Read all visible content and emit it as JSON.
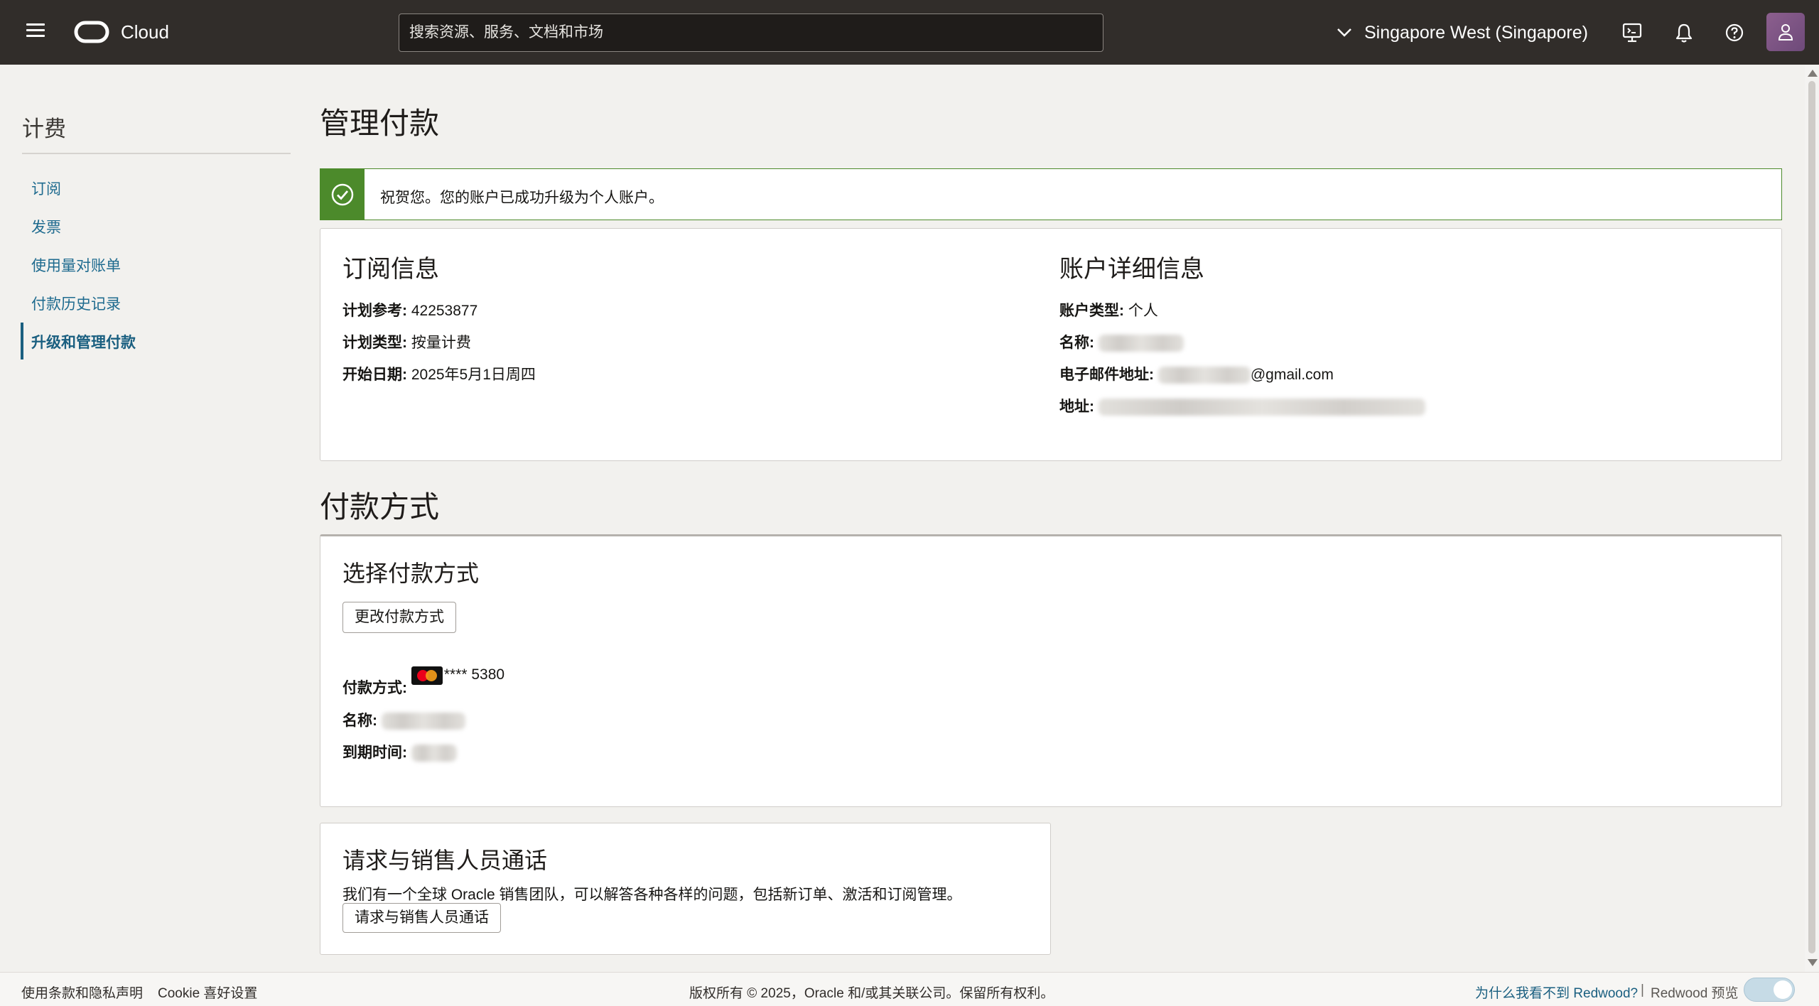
{
  "header": {
    "brand": "Cloud",
    "search_placeholder": "搜索资源、服务、文档和市场",
    "region": "Singapore West (Singapore)"
  },
  "sidebar": {
    "title": "计费",
    "items": [
      {
        "label": "订阅"
      },
      {
        "label": "发票"
      },
      {
        "label": "使用量对账单"
      },
      {
        "label": "付款历史记录"
      },
      {
        "label": "升级和管理付款"
      }
    ]
  },
  "main": {
    "title": "管理付款",
    "alert": "祝贺您。您的账户已成功升级为个人账户。",
    "subscription": {
      "heading": "订阅信息",
      "plan_ref_label": "计划参考:",
      "plan_ref_value": "42253877",
      "plan_type_label": "计划类型:",
      "plan_type_value": "按量计费",
      "start_date_label": "开始日期:",
      "start_date_value": "2025年5月1日周四"
    },
    "account": {
      "heading": "账户详细信息",
      "type_label": "账户类型:",
      "type_value": "个人",
      "name_label": "名称:",
      "email_label": "电子邮件地址:",
      "email_suffix": "@gmail.com",
      "address_label": "地址:"
    },
    "payment_section_title": "付款方式",
    "payment": {
      "heading": "选择付款方式",
      "change_button": "更改付款方式",
      "method_label": "付款方式:",
      "card_number": "**** 5380",
      "name_label": "名称:",
      "expiry_label": "到期时间:"
    },
    "sales": {
      "heading": "请求与销售人员通话",
      "description": "我们有一个全球 Oracle 销售团队，可以解答各种各样的问题，包括新订单、激活和订阅管理。",
      "button": "请求与销售人员通话"
    }
  },
  "footer": {
    "terms": "使用条款和隐私声明",
    "cookie": "Cookie 喜好设置",
    "copyright": "版权所有 © 2025，Oracle 和/或其关联公司。保留所有权利。",
    "why_redwood": "为什么我看不到 Redwood?",
    "separator": "|",
    "redwood_preview": "Redwood 预览"
  }
}
